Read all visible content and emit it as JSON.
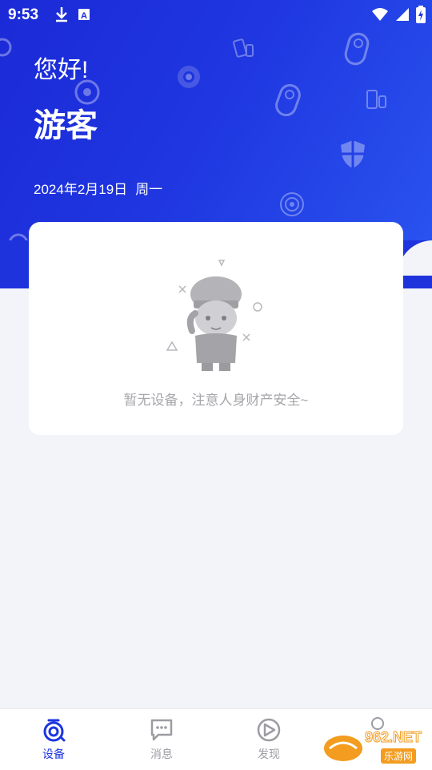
{
  "status_bar": {
    "time": "9:53"
  },
  "header": {
    "greeting": "您好!",
    "username": "游客",
    "date": "2024年2月19日",
    "weekday": "周一"
  },
  "device_card": {
    "empty_message": "暂无设备，注意人身财产安全~"
  },
  "tabbar": {
    "tabs": [
      {
        "label": "设备",
        "icon": "device-icon",
        "active": true
      },
      {
        "label": "消息",
        "icon": "message-icon",
        "active": false
      },
      {
        "label": "发现",
        "icon": "discover-icon",
        "active": false
      }
    ]
  },
  "watermark": {
    "text": "962.NET",
    "sub": "乐游网"
  },
  "colors": {
    "brand": "#1d35e0",
    "background": "#f3f4f9",
    "inactive": "#9c9ca3"
  }
}
